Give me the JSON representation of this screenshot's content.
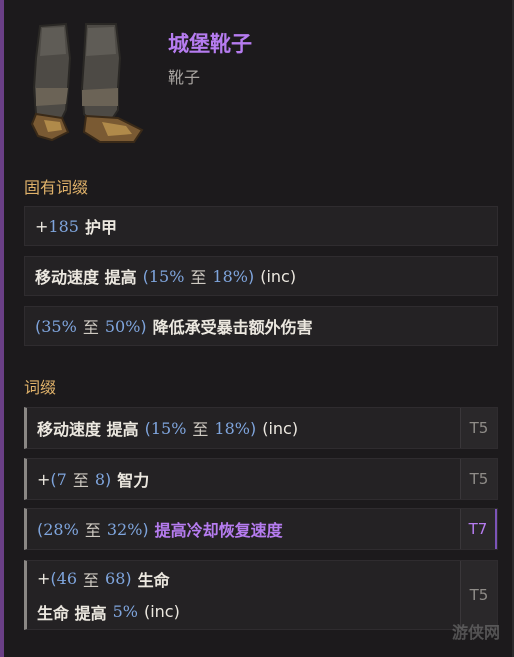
{
  "item": {
    "name": "城堡靴子",
    "type": "靴子",
    "icon": "boots-icon"
  },
  "implicit": {
    "title": "固有词缀",
    "rows": [
      {
        "prefix": "+",
        "value": "185",
        "label": "护甲"
      },
      {
        "label": "移动速度 提高",
        "range_open": "(",
        "min": "15%",
        "to": "至",
        "max": "18%",
        "range_close": ")",
        "suffix": "(inc)"
      },
      {
        "range_open": "(",
        "min": "35%",
        "to": "至",
        "max": "50%",
        "range_close": ")",
        "label": "降低承受暴击额外伤害"
      }
    ]
  },
  "affixes": {
    "title": "词缀",
    "rows": [
      {
        "label": "移动速度 提高",
        "range_open": "(",
        "min": "15%",
        "to": "至",
        "max": "18%",
        "range_close": ")",
        "suffix": "(inc)",
        "tier": "T5"
      },
      {
        "prefix": "+",
        "range_open": "(",
        "min": "7",
        "to": "至",
        "max": "8",
        "range_close": ")",
        "label": "智力",
        "tier": "T5"
      },
      {
        "range_open": "(",
        "min": "28%",
        "to": "至",
        "max": "32%",
        "range_close": ")",
        "label": "提高冷却恢复速度",
        "tier": "T7",
        "tier_color": "#b67cf0"
      },
      {
        "line1": {
          "prefix": "+",
          "range_open": "(",
          "min": "46",
          "to": "至",
          "max": "68",
          "range_close": ")",
          "label": "生命"
        },
        "line2": {
          "label": "生命 提高",
          "value": "5%",
          "suffix": "(inc)"
        },
        "tier": "T5"
      }
    ]
  },
  "watermark": "游侠网",
  "colors": {
    "unique": "#b67cf0",
    "section": "#e0b26a",
    "number": "#7fa5dd"
  }
}
